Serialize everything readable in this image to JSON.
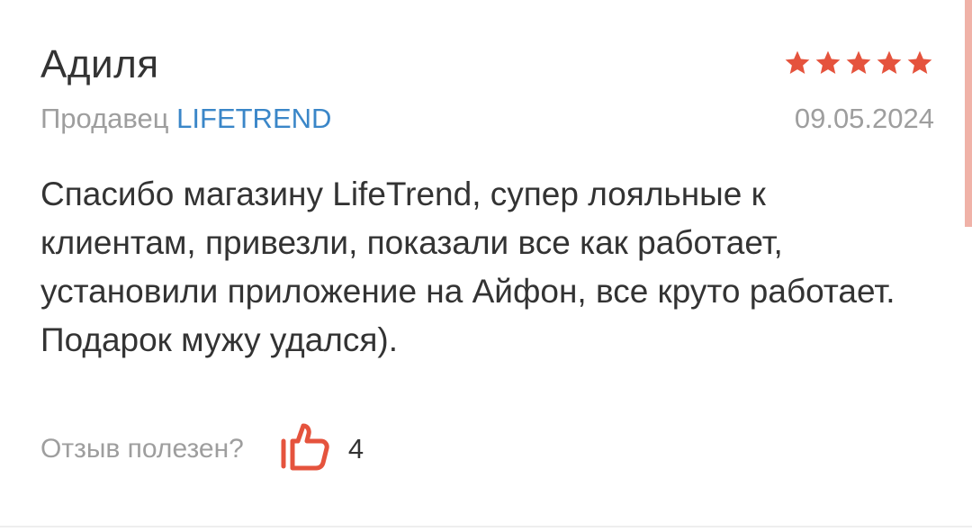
{
  "review": {
    "author": "Адиля",
    "rating": 5,
    "rating_max": 5,
    "star_icon": "star-icon",
    "star_color": "#e5533d",
    "seller_prefix": "Продавец",
    "seller_name": "LIFETREND",
    "seller_color": "#3a86c8",
    "date": "09.05.2024",
    "text": "Спасибо магазину LifeTrend, супер лояльные к клиентам, привезли, показали все как работает, установили приложение на Айфон, все круто работает. Подарок мужу удался).",
    "helpful_label": "Отзыв полезен?",
    "like_icon": "thumbs-up-icon",
    "like_color": "#e5533d",
    "like_count": "4"
  }
}
